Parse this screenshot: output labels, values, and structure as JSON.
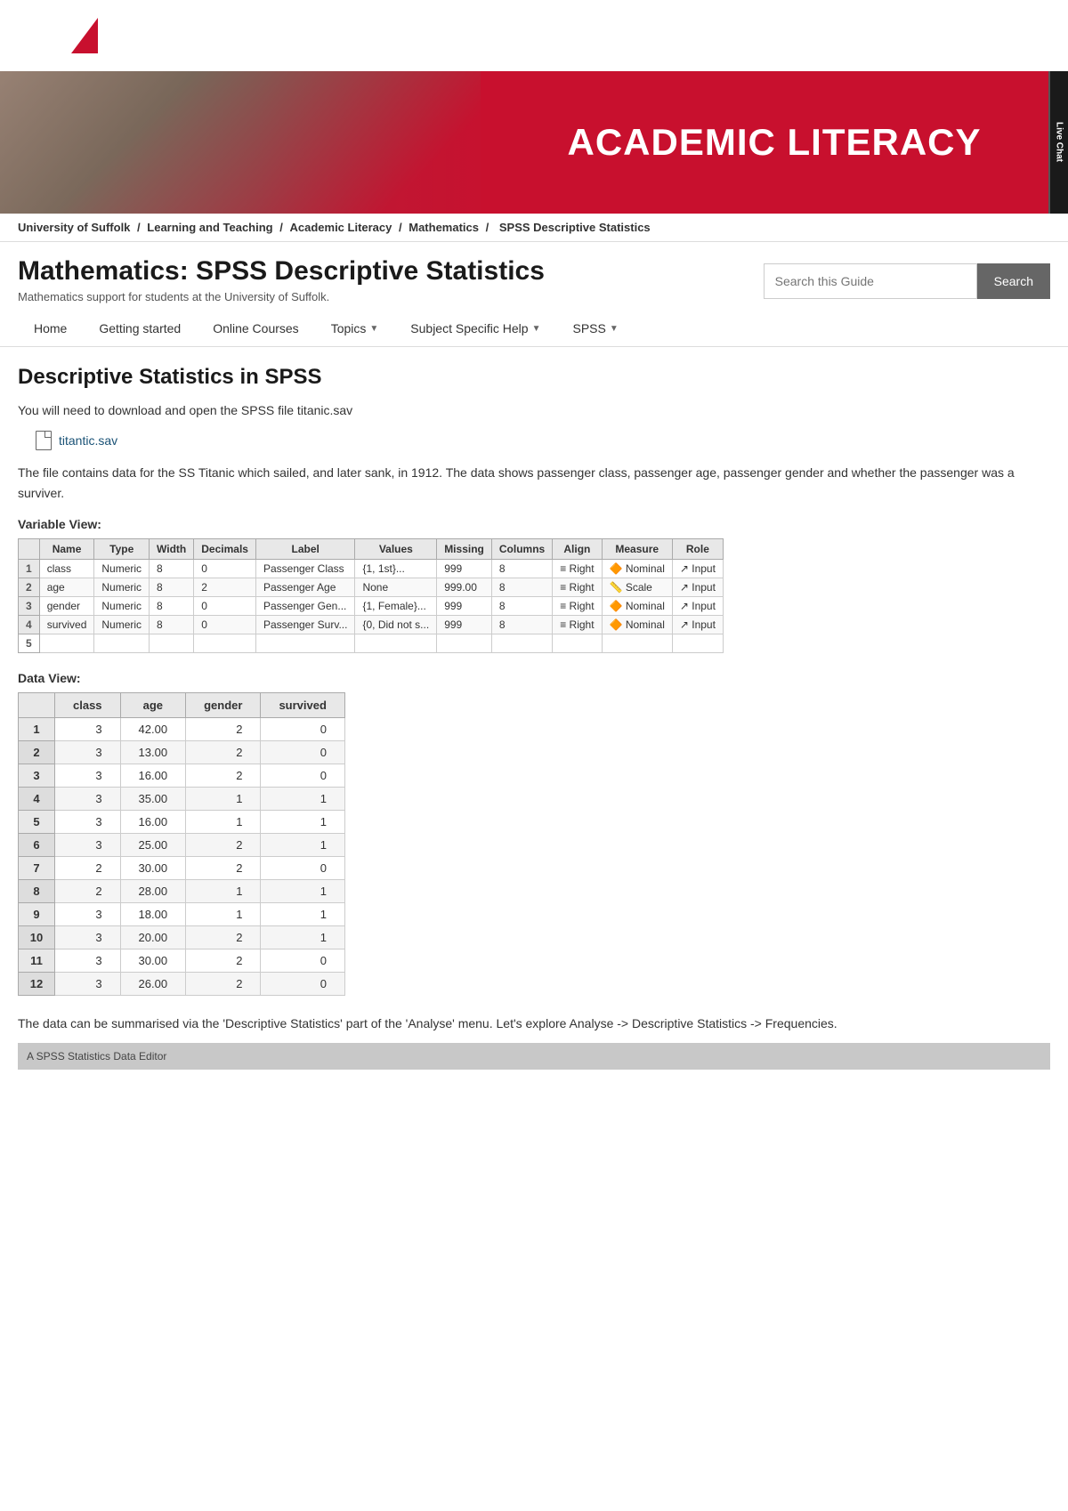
{
  "topbar": {
    "logo_alt": "University logo"
  },
  "hero": {
    "title": "ACADEMIC LITERACY",
    "live_chat": "Live Chat"
  },
  "breadcrumb": {
    "items": [
      "University of Suffolk",
      "Learning and Teaching",
      "Academic Literacy",
      "Mathematics",
      "SPSS Descriptive Statistics"
    ]
  },
  "page": {
    "title": "Mathematics: SPSS Descriptive Statistics",
    "subtitle": "Mathematics support for students at the University of Suffolk."
  },
  "search": {
    "placeholder": "Search this Guide",
    "button_label": "Search"
  },
  "nav": {
    "items": [
      {
        "label": "Home",
        "has_dropdown": false
      },
      {
        "label": "Getting started",
        "has_dropdown": false
      },
      {
        "label": "Online Courses",
        "has_dropdown": false
      },
      {
        "label": "Topics",
        "has_dropdown": true
      },
      {
        "label": "Subject Specific Help",
        "has_dropdown": true
      },
      {
        "label": "SPSS",
        "has_dropdown": true
      }
    ]
  },
  "main": {
    "section_heading": "Descriptive Statistics in SPSS",
    "intro_text": "You will need to download and open the SPSS file titanic.sav",
    "file_name": "titantic.sav",
    "body_text1": "The file contains data for the SS Titanic which sailed, and later sank, in 1912. The data shows passenger class, passenger age, passenger gender and whether the passenger was a surviver.",
    "variable_view_title": "Variable View:",
    "variable_table": {
      "headers": [
        "",
        "Name",
        "Type",
        "Width",
        "Decimals",
        "Label",
        "Values",
        "Missing",
        "Columns",
        "Align",
        "Measure",
        "Role"
      ],
      "rows": [
        {
          "num": "1",
          "name": "class",
          "type": "Numeric",
          "width": "8",
          "decimals": "0",
          "label": "Passenger Class",
          "values": "{1, 1st}...",
          "missing": "999",
          "columns": "8",
          "align": "Right",
          "measure": "Nominal",
          "role": "Input"
        },
        {
          "num": "2",
          "name": "age",
          "type": "Numeric",
          "width": "8",
          "decimals": "2",
          "label": "Passenger Age",
          "values": "None",
          "missing": "999.00",
          "columns": "8",
          "align": "Right",
          "measure": "Scale",
          "role": "Input"
        },
        {
          "num": "3",
          "name": "gender",
          "type": "Numeric",
          "width": "8",
          "decimals": "0",
          "label": "Passenger Gen...",
          "values": "{1, Female}...",
          "missing": "999",
          "columns": "8",
          "align": "Right",
          "measure": "Nominal",
          "role": "Input"
        },
        {
          "num": "4",
          "name": "survived",
          "type": "Numeric",
          "width": "8",
          "decimals": "0",
          "label": "Passenger Surv...",
          "values": "{0, Did not s...",
          "missing": "999",
          "columns": "8",
          "align": "Right",
          "measure": "Nominal",
          "role": "Input"
        },
        {
          "num": "5",
          "name": "",
          "type": "",
          "width": "",
          "decimals": "",
          "label": "",
          "values": "",
          "missing": "",
          "columns": "",
          "align": "",
          "measure": "",
          "role": ""
        }
      ]
    },
    "data_view_title": "Data View:",
    "data_table": {
      "headers": [
        "",
        "class",
        "age",
        "gender",
        "survived"
      ],
      "rows": [
        {
          "num": "1",
          "class": "3",
          "age": "42.00",
          "gender": "2",
          "survived": "0"
        },
        {
          "num": "2",
          "class": "3",
          "age": "13.00",
          "gender": "2",
          "survived": "0"
        },
        {
          "num": "3",
          "class": "3",
          "age": "16.00",
          "gender": "2",
          "survived": "0"
        },
        {
          "num": "4",
          "class": "3",
          "age": "35.00",
          "gender": "1",
          "survived": "1"
        },
        {
          "num": "5",
          "class": "3",
          "age": "16.00",
          "gender": "1",
          "survived": "1"
        },
        {
          "num": "6",
          "class": "3",
          "age": "25.00",
          "gender": "2",
          "survived": "1"
        },
        {
          "num": "7",
          "class": "2",
          "age": "30.00",
          "gender": "2",
          "survived": "0"
        },
        {
          "num": "8",
          "class": "2",
          "age": "28.00",
          "gender": "1",
          "survived": "1"
        },
        {
          "num": "9",
          "class": "3",
          "age": "18.00",
          "gender": "1",
          "survived": "1"
        },
        {
          "num": "10",
          "class": "3",
          "age": "20.00",
          "gender": "2",
          "survived": "1"
        },
        {
          "num": "11",
          "class": "3",
          "age": "30.00",
          "gender": "2",
          "survived": "0"
        },
        {
          "num": "12",
          "class": "3",
          "age": "26.00",
          "gender": "2",
          "survived": "0"
        }
      ]
    },
    "bottom_text": "The data can be summarised via the 'Descriptive Statistics' part of the 'Analyse' menu. Let's explore Analyse -> Descriptive Statistics -> Frequencies.",
    "footer_hint": "A SPSS Statistics Data Editor"
  }
}
